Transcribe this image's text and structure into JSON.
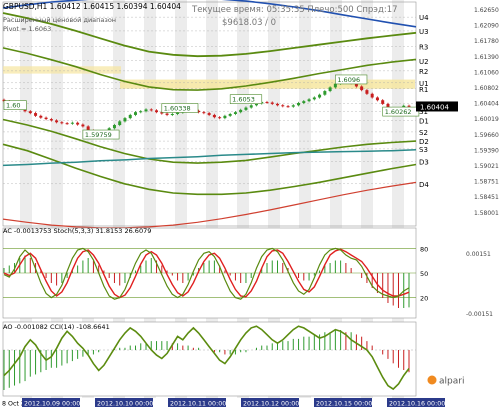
{
  "header": {
    "symbol_line": "GBPUSD,H1  1.60412 1.60415 1.60394 1.60404",
    "caption1": "Расширенный ценовой диапазон",
    "caption2": "Pivot = 1.6063",
    "status": "Текущее время: 05:35:35  Плечо:500  Спрэд:17",
    "balance": "$9618.03",
    "slash": "/ 0"
  },
  "logo": "alpari",
  "colors": {
    "background": "#ffffff",
    "bull": "#2e9a2e",
    "bear": "#c81e1e",
    "level_band": "#f6e6a0",
    "stripe": "#ececec",
    "ma_green": "#5a8a10",
    "ma_blue": "#2050b0",
    "ma_teal": "#2a8a8a",
    "ma_red": "#d04030",
    "sig_red": "#e02020",
    "osc_green": "#5c8c10"
  },
  "chart_data": [
    {
      "type": "line",
      "title": "GBPUSD,H1",
      "ylim": [
        1.578,
        1.6268
      ],
      "y_ticks": [
        "1.62650",
        "1.62090",
        "1.61780",
        "1.61390",
        "1.61060",
        "1.60802",
        "1.60404",
        "1.60019",
        "1.59660",
        "1.59390",
        "1.59021",
        "1.58751",
        "1.58451",
        "1.58001"
      ],
      "levels": [
        {
          "name": "U4",
          "value": 1.6235
        },
        {
          "name": "U3",
          "value": 1.6205
        },
        {
          "name": "R3",
          "value": 1.6171
        },
        {
          "name": "U2",
          "value": 1.614
        },
        {
          "name": "R2",
          "value": 1.6118
        },
        {
          "name": "U1",
          "value": 1.6092
        },
        {
          "name": "R1",
          "value": 1.6079
        },
        {
          "name": "LB",
          "value": 1.6047
        },
        {
          "name": "S1",
          "value": 1.603
        },
        {
          "name": "D1",
          "value": 1.601
        },
        {
          "name": "S2",
          "value": 1.5985
        },
        {
          "name": "D2",
          "value": 1.5965
        },
        {
          "name": "S3",
          "value": 1.5948
        },
        {
          "name": "D3",
          "value": 1.592
        },
        {
          "name": "D4",
          "value": 1.5872
        }
      ],
      "annotations": [
        {
          "text": "1.6096",
          "x": 63,
          "y": 1.6096
        },
        {
          "text": "1.6053",
          "x": 43,
          "y": 1.6053
        },
        {
          "text": "1.60338",
          "x": 30,
          "y": 1.6034
        },
        {
          "text": "1.59759",
          "x": 15,
          "y": 1.5976
        },
        {
          "text": "1.60262",
          "x": 72,
          "y": 1.6026
        },
        {
          "text": "1.60",
          "x": 0,
          "y": 1.604
        }
      ],
      "x_labels": [
        "8 Oct 2012",
        "2012.10.09 00:00",
        "2012.10.10 00:00",
        "2012.10.11 00:00",
        "2012.10.12 00:00",
        "2012.10.15 00:00",
        "2012.10.16 00:00"
      ],
      "close": [
        1.6052,
        1.6046,
        1.6041,
        1.6035,
        1.603,
        1.6026,
        1.602,
        1.6016,
        1.6013,
        1.601,
        1.6006,
        1.6004,
        1.6003,
        1.6005,
        1.6001,
        1.5997,
        1.5988,
        1.5982,
        1.5979,
        1.5985,
        1.5993,
        1.6,
        1.6008,
        1.6015,
        1.6022,
        1.6028,
        1.603,
        1.6034,
        1.6032,
        1.6028,
        1.6025,
        1.6022,
        1.6024,
        1.6027,
        1.6031,
        1.6034,
        1.6031,
        1.6028,
        1.6026,
        1.6022,
        1.6017,
        1.6015,
        1.602,
        1.6024,
        1.6028,
        1.6033,
        1.6038,
        1.6043,
        1.6047,
        1.605,
        1.6049,
        1.6046,
        1.6043,
        1.6041,
        1.604,
        1.6043,
        1.6048,
        1.6052,
        1.6056,
        1.606,
        1.6066,
        1.6074,
        1.6082,
        1.609,
        1.6094,
        1.6096,
        1.6091,
        1.6084,
        1.6076,
        1.6068,
        1.606,
        1.6054,
        1.6046,
        1.6035,
        1.6028,
        1.6036,
        1.6042,
        1.604
      ],
      "ma_green_top": [
        1.6244,
        1.6233,
        1.622,
        1.6205,
        1.6189,
        1.6173,
        1.616,
        1.6153,
        1.615,
        1.6151,
        1.6155,
        1.6161,
        1.6168,
        1.6175,
        1.6182,
        1.6189,
        1.6195,
        1.6201
      ],
      "ma_green_mid": [
        1.6168,
        1.6156,
        1.6142,
        1.6127,
        1.611,
        1.6095,
        1.6083,
        1.6077,
        1.6076,
        1.6079,
        1.6085,
        1.6093,
        1.6102,
        1.6112,
        1.6121,
        1.613,
        1.6137,
        1.6143
      ],
      "ma_green_low": [
        1.6012,
        1.6,
        1.5986,
        1.597,
        1.5953,
        1.5938,
        1.5926,
        1.5919,
        1.5917,
        1.5919,
        1.5923,
        1.593,
        1.5938,
        1.5945,
        1.5952,
        1.5958,
        1.5962,
        1.5965
      ],
      "ma_green_bottom": [
        1.5958,
        1.5944,
        1.5925,
        1.5906,
        1.5888,
        1.5872,
        1.586,
        1.5852,
        1.5849,
        1.5849,
        1.5852,
        1.5858,
        1.5866,
        1.5875,
        1.5885,
        1.5895,
        1.5905,
        1.5914
      ],
      "ma_blue_top": [
        1.6255,
        1.6262,
        1.6268,
        1.6272,
        1.6276,
        1.6278,
        1.6279,
        1.6279,
        1.6277,
        1.6274,
        1.627,
        1.6264,
        1.6257,
        1.6249,
        1.624,
        1.6231,
        1.6222,
        1.6214
      ],
      "ma_teal": [
        1.5912,
        1.5914,
        1.5917,
        1.5919,
        1.5922,
        1.5924,
        1.5927,
        1.5929,
        1.5931,
        1.5934,
        1.5936,
        1.5938,
        1.594,
        1.5941,
        1.5942,
        1.5943,
        1.5944,
        1.5946
      ],
      "ma_red": [
        1.5795,
        1.5788,
        1.5782,
        1.5778,
        1.5776,
        1.5776,
        1.5778,
        1.5782,
        1.5788,
        1.5796,
        1.5805,
        1.5815,
        1.5826,
        1.5837,
        1.5848,
        1.5858,
        1.5867,
        1.5875
      ]
    },
    {
      "type": "line",
      "title": "AC -0.0013753  Stoch(5,3,3) 31.8153 26.6079",
      "ylim": [
        -0.0016,
        0.0016
      ],
      "y_ticks": [
        "80",
        "50",
        "20"
      ],
      "right_ticks": [
        "0.00151",
        "-0.00151"
      ],
      "stoch_main": [
        48,
        45,
        55,
        70,
        78,
        72,
        55,
        38,
        25,
        20,
        24,
        35,
        52,
        68,
        78,
        80,
        76,
        66,
        50,
        34,
        22,
        18,
        20,
        30,
        46,
        62,
        74,
        78,
        74,
        62,
        48,
        34,
        24,
        20,
        24,
        36,
        52,
        66,
        74,
        76,
        70,
        58,
        42,
        28,
        20,
        18,
        24,
        38,
        56,
        70,
        78,
        80,
        76,
        66,
        52,
        38,
        28,
        24,
        30,
        44,
        60,
        72,
        78,
        80,
        78,
        72,
        68,
        66,
        58,
        46,
        34,
        28,
        24,
        22,
        20,
        22,
        28,
        31.8
      ],
      "stoch_signal": [
        50,
        47,
        50,
        60,
        70,
        74,
        68,
        54,
        40,
        28,
        22,
        27,
        38,
        54,
        68,
        76,
        78,
        72,
        62,
        48,
        34,
        24,
        20,
        23,
        32,
        46,
        61,
        72,
        76,
        72,
        62,
        48,
        36,
        26,
        22,
        27,
        38,
        52,
        64,
        72,
        74,
        68,
        56,
        42,
        30,
        22,
        21,
        28,
        40,
        56,
        70,
        77,
        78,
        74,
        64,
        52,
        40,
        30,
        27,
        33,
        46,
        60,
        72,
        77,
        79,
        76,
        72,
        68,
        64,
        56,
        46,
        36,
        29,
        25,
        22,
        22,
        24,
        26.6
      ],
      "ac_histogram": [
        0.0002,
        0.0003,
        0.0004,
        0.0006,
        0.0007,
        0.0006,
        0.0004,
        0.0001,
        -0.0002,
        -0.0004,
        -0.0005,
        -0.0004,
        -0.0002,
        0.0001,
        0.0003,
        0.0005,
        0.0006,
        0.0005,
        0.0003,
        0.0001,
        -0.0002,
        -0.0004,
        -0.0005,
        -0.0004,
        -0.0002,
        0.0001,
        0.0003,
        0.0005,
        0.0006,
        0.0005,
        0.0003,
        0.0001,
        -0.0001,
        -0.0003,
        -0.0004,
        -0.0003,
        -0.0001,
        0.0002,
        0.0004,
        0.0005,
        0.0005,
        0.0003,
        0.0001,
        -0.0001,
        -0.0003,
        -0.0004,
        -0.0004,
        -0.0002,
        0.0,
        0.0002,
        0.0004,
        0.0005,
        0.0005,
        0.0004,
        0.0002,
        0.0,
        -0.0002,
        -0.0003,
        -0.0003,
        -0.0001,
        0.0001,
        0.0003,
        0.0004,
        0.0005,
        0.0005,
        0.0004,
        0.0002,
        0.0,
        -0.0002,
        -0.0004,
        -0.0006,
        -0.0008,
        -0.001,
        -0.0012,
        -0.0013,
        -0.0014,
        -0.0014,
        -0.0013753
      ]
    },
    {
      "type": "line",
      "title": "AO -0.001082  CCI(14) -108.6641",
      "ylim": [
        -0.0028,
        0.0022
      ],
      "ao_histogram": [
        -0.0018,
        -0.0017,
        -0.0016,
        -0.0015,
        -0.0014,
        -0.0012,
        -0.0011,
        -0.001,
        -0.0009,
        -0.0008,
        -0.0008,
        -0.0007,
        -0.0006,
        -0.0005,
        -0.0004,
        -0.0003,
        -0.0002,
        -0.0002,
        -0.0001,
        0.0,
        0.0,
        0.0001,
        0.0001,
        0.0001,
        0.0002,
        0.0002,
        0.0003,
        0.0003,
        0.0004,
        0.0004,
        0.0004,
        0.0004,
        0.0003,
        0.0003,
        0.0002,
        0.0002,
        0.0001,
        0.0001,
        0.0,
        0.0,
        -0.0001,
        -0.0001,
        -0.0002,
        -0.0002,
        -0.0002,
        -0.0001,
        -0.0001,
        0.0,
        0.0001,
        0.0002,
        0.0002,
        0.0003,
        0.0003,
        0.0004,
        0.0004,
        0.0005,
        0.0005,
        0.0006,
        0.0006,
        0.0007,
        0.0007,
        0.0008,
        0.0008,
        0.0009,
        0.0009,
        0.0008,
        0.0008,
        0.0007,
        0.0006,
        0.0004,
        0.0002,
        0.0,
        -0.0002,
        -0.0004,
        -0.0006,
        -0.0008,
        -0.0009,
        -0.001
      ],
      "cci": [
        -150,
        -120,
        -80,
        -40,
        20,
        60,
        30,
        -20,
        -60,
        -40,
        10,
        70,
        110,
        80,
        40,
        10,
        -30,
        -80,
        -120,
        -90,
        -40,
        10,
        60,
        100,
        130,
        110,
        80,
        40,
        0,
        -30,
        -50,
        -20,
        30,
        80,
        60,
        100,
        130,
        100,
        60,
        20,
        -20,
        -60,
        -80,
        -40,
        10,
        60,
        100,
        130,
        140,
        120,
        90,
        60,
        40,
        60,
        90,
        120,
        140,
        130,
        110,
        90,
        70,
        80,
        100,
        120,
        110,
        90,
        60,
        40,
        20,
        0,
        -40,
        -100,
        -160,
        -210,
        -230,
        -200,
        -150,
        -108.7
      ]
    }
  ]
}
